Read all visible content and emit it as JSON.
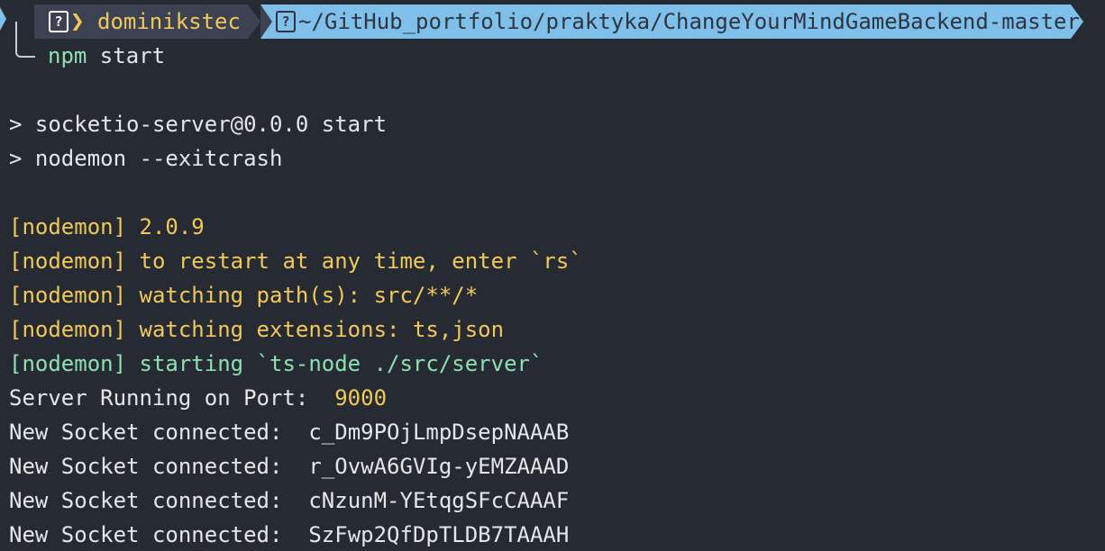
{
  "prompt": {
    "username": "dominikstec",
    "path": "~/GitHub_portfolio/praktyka/ChangeYourMindGameBackend-master",
    "command_name": "npm",
    "command_args": " start"
  },
  "output": {
    "npm_script_1": "> socketio-server@0.0.0 start",
    "npm_script_2": "> nodemon --exitcrash",
    "nodemon_tag": "[nodemon]",
    "nodemon_version": " 2.0.9",
    "nodemon_restart": " to restart at any time, enter `rs`",
    "nodemon_watch_path": " watching path(s): src/**/*",
    "nodemon_watch_ext": " watching extensions: ts,json",
    "nodemon_starting": " starting `ts-node ./src/server`",
    "server_label": "Server Running on Port:  ",
    "server_port": "9000",
    "socket_label": "New Socket connected:  ",
    "sockets": [
      "c_Dm9POjLmpDsepNAAAB",
      "r_OvwA6GVIg-yEMZAAAD",
      "cNzunM-YEtqgSFcCAAAF",
      "SzFwp2QfDpTLDB7TAAAH"
    ]
  },
  "colors": {
    "background": "#262a33",
    "path_segment": "#7fc0ea",
    "user_segment": "#3c4251",
    "yellow": "#f0c95a",
    "green": "#8ee0b0",
    "text": "#e4e6ea"
  },
  "icons": {
    "user": "question-box-icon",
    "folder": "question-box-icon",
    "separator": "chevron-right-icon"
  }
}
